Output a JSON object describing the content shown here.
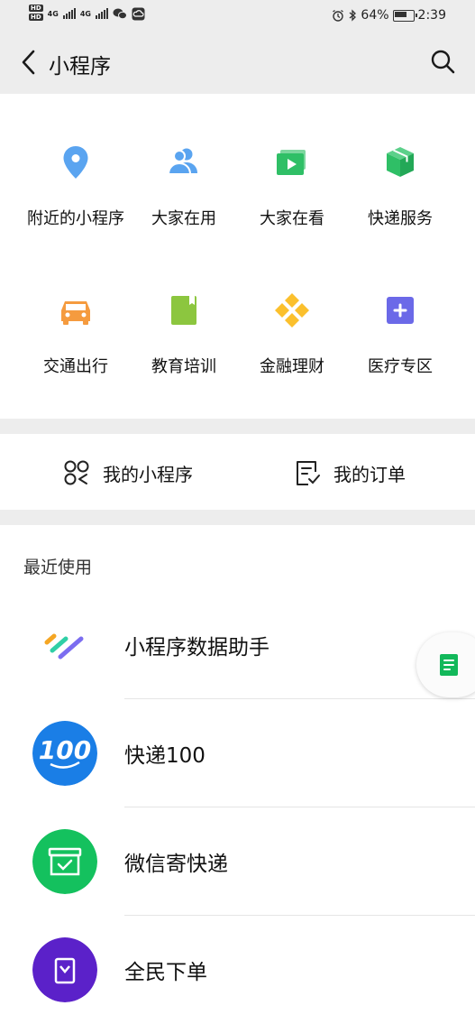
{
  "status_bar": {
    "net1": "4G",
    "net2": "4G",
    "battery": "64%",
    "time": "2:39"
  },
  "header": {
    "title": "小程序"
  },
  "grid": [
    {
      "label": "附近的小程序",
      "icon": "location-pin-icon",
      "color": "#5aa4f0"
    },
    {
      "label": "大家在用",
      "icon": "users-icon",
      "color": "#5aa4f0"
    },
    {
      "label": "大家在看",
      "icon": "video-icon",
      "color": "#2fbf66"
    },
    {
      "label": "快递服务",
      "icon": "package-icon",
      "color": "#2fbf66"
    },
    {
      "label": "交通出行",
      "icon": "car-icon",
      "color": "#f59b3f"
    },
    {
      "label": "教育培训",
      "icon": "book-icon",
      "color": "#8cc63f"
    },
    {
      "label": "金融理财",
      "icon": "diamond-grid-icon",
      "color": "#fbc02d"
    },
    {
      "label": "医疗专区",
      "icon": "medical-plus-icon",
      "color": "#6b69e8"
    }
  ],
  "mine": {
    "my_mini_programs": "我的小程序",
    "my_orders": "我的订单"
  },
  "recent": {
    "title": "最近使用",
    "items": [
      {
        "name": "小程序数据助手",
        "icon": "data-assistant-logo"
      },
      {
        "name": "快递100",
        "icon": "kuaidi100-logo",
        "logo_text": "100"
      },
      {
        "name": "微信寄快递",
        "icon": "wechat-express-logo"
      },
      {
        "name": "全民下单",
        "icon": "quanmin-logo"
      }
    ]
  },
  "floating": {
    "icon": "document-icon",
    "color": "#12b85a"
  }
}
